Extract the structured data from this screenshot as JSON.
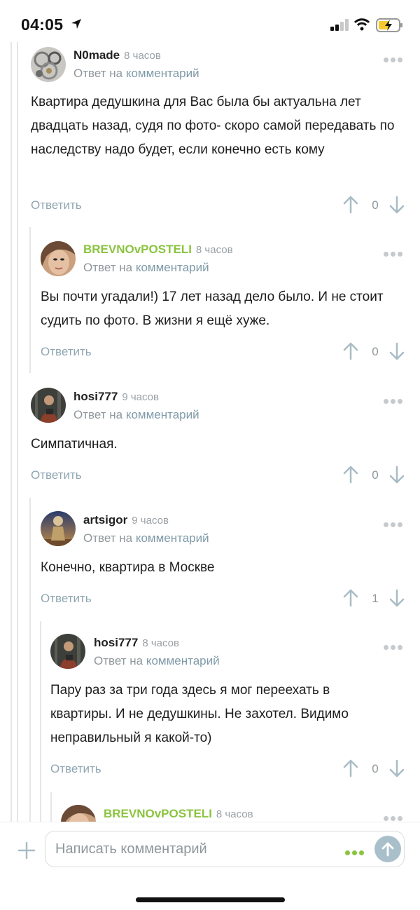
{
  "status_bar": {
    "time": "04:05"
  },
  "common": {
    "reply_to_prefix": "Ответ на",
    "reply_to_link": "комментарий",
    "reply_label": "Ответить"
  },
  "comments": [
    {
      "author": "N0made",
      "time": "8 часов",
      "text": "Квартира дедушкина для Вас была бы актуальна лет двадцать назад, судя по фото- скоро самой передавать по наследству надо будет, если конечно есть кому",
      "votes": "0"
    },
    {
      "author": "BREVNOvPOSTELI",
      "time": "8 часов",
      "text": "Вы почти угадали!) 17 лет назад дело было. И не стоит судить по фото. В жизни я ещё хуже.",
      "votes": "0"
    },
    {
      "author": "hosi777",
      "time": "9 часов",
      "text": "Симпатичная.",
      "votes": "0"
    },
    {
      "author": "artsigor",
      "time": "9 часов",
      "text": "Конечно, квартира в Москве",
      "votes": "1"
    },
    {
      "author": "hosi777",
      "time": "8 часов",
      "text": "Пару раз за три года здесь я мог переехать в квартиры. И не дедушкины. Не захотел. Видимо неправильный я какой-то)",
      "votes": "0"
    },
    {
      "author": "BREVNOvPOSTELI",
      "time": "8 часов"
    }
  ],
  "composer": {
    "placeholder": "Написать комментарий"
  },
  "colors": {
    "accent_green": "#8ac43f",
    "link_blue_gray": "#8fa6b2",
    "send_button": "#a9c0cb"
  }
}
